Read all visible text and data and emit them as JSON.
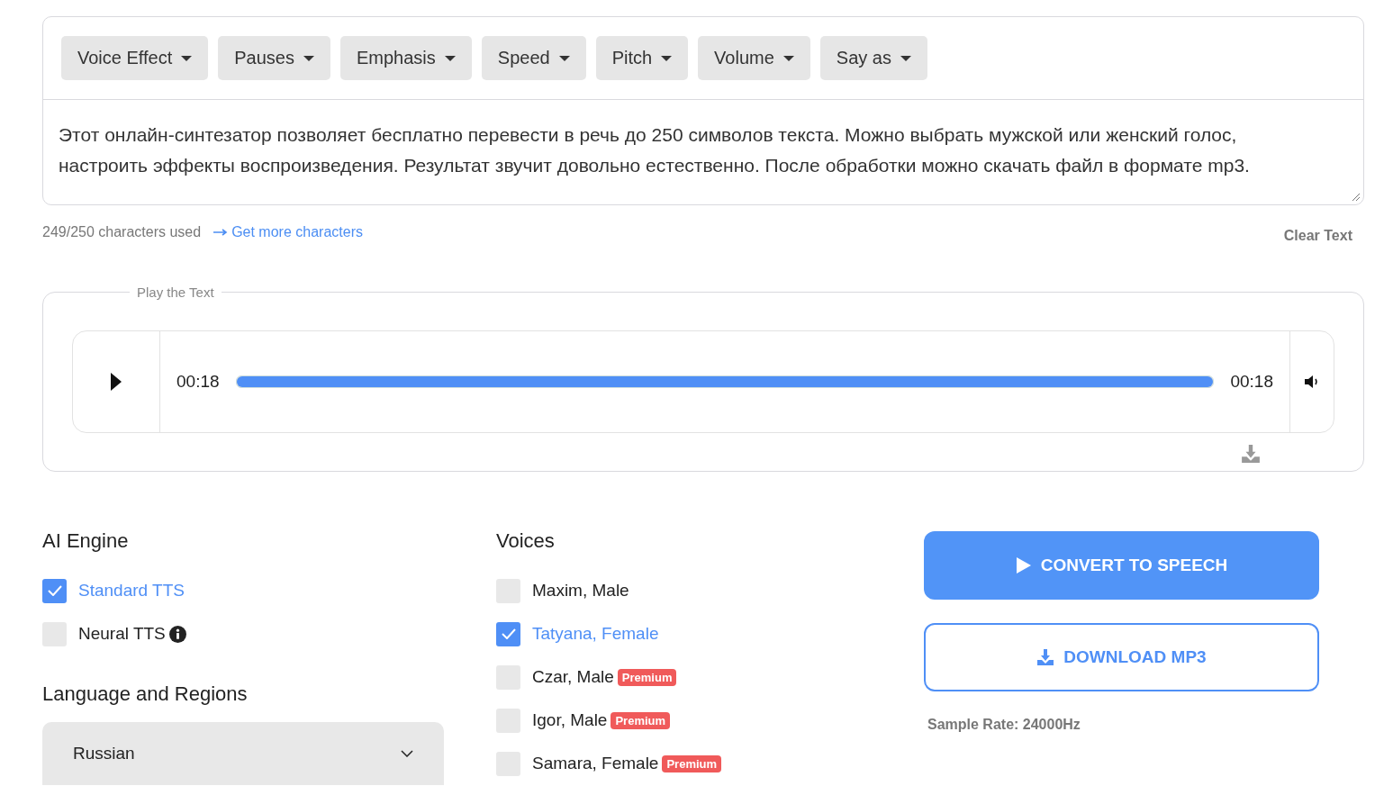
{
  "toolbar": [
    {
      "label": "Voice Effect"
    },
    {
      "label": "Pauses"
    },
    {
      "label": "Emphasis"
    },
    {
      "label": "Speed"
    },
    {
      "label": "Pitch"
    },
    {
      "label": "Volume"
    },
    {
      "label": "Say as"
    }
  ],
  "text": "Этот онлайн-синтезатор позволяет бесплатно перевести в речь до 250 символов текста. Можно выбрать мужской или женский голос, настроить эффекты воспроизведения. Результат звучит довольно естественно. После обработки можно скачать файл в формате mp3.",
  "counter": "249/250 characters used",
  "more_link": "Get more characters",
  "clear": "Clear Text",
  "player": {
    "legend": "Play the Text",
    "current": "00:18",
    "duration": "00:18",
    "level": 1
  },
  "engine": {
    "title": "AI Engine",
    "options": [
      {
        "label": "Standard TTS",
        "selected": true,
        "info": false
      },
      {
        "label": "Neural TTS",
        "selected": false,
        "info": true
      }
    ]
  },
  "language": {
    "title": "Language and Regions",
    "value": "Russian"
  },
  "voices": {
    "title": "Voices",
    "items": [
      {
        "label": "Maxim, Male",
        "selected": false
      },
      {
        "label": "Tatyana, Female",
        "selected": true
      },
      {
        "label": "Czar, Male",
        "selected": false,
        "badge": "Premium"
      },
      {
        "label": "Igor, Male",
        "selected": false,
        "badge": "Premium"
      },
      {
        "label": "Samara, Female",
        "selected": false,
        "badge": "Premium"
      }
    ]
  },
  "convert": "CONVERT TO SPEECH",
  "download": "DOWNLOAD MP3",
  "sample_rate": "Sample Rate: 24000Hz"
}
